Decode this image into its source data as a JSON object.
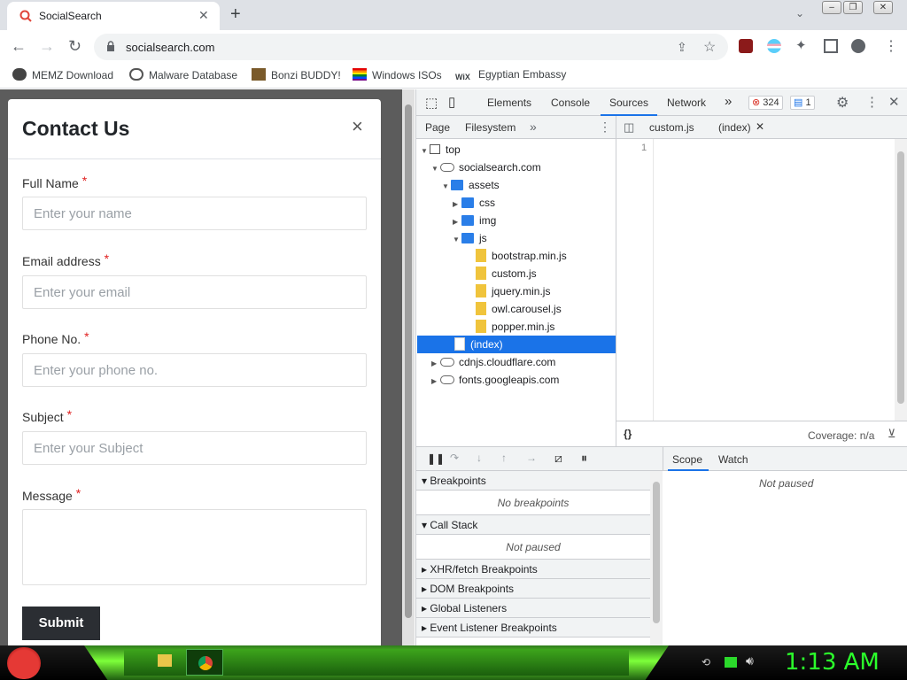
{
  "browser": {
    "tab_title": "SocialSearch",
    "url": "socialsearch.com",
    "bookmarks": [
      "MEMZ Download",
      "Malware Database",
      "Bonzi BUDDY!",
      "Windows ISOs",
      "Egyptian Embassy"
    ]
  },
  "modal": {
    "title": "Contact Us",
    "close_glyph": "×",
    "fields": [
      {
        "label": "Full Name",
        "placeholder": "Enter your name"
      },
      {
        "label": "Email address",
        "placeholder": "Enter your email"
      },
      {
        "label": "Phone No.",
        "placeholder": "Enter your phone no."
      },
      {
        "label": "Subject",
        "placeholder": "Enter your Subject"
      },
      {
        "label": "Message",
        "placeholder": ""
      }
    ],
    "required_mark": "*",
    "submit_label": "Submit"
  },
  "devtools": {
    "tabs": [
      "Elements",
      "Console",
      "Sources",
      "Network"
    ],
    "active_tab": "Sources",
    "more_glyph": "»",
    "error_count": "324",
    "message_count": "1",
    "navigator_tabs": [
      "Page",
      "Filesystem"
    ],
    "editor_tabs": [
      "custom.js",
      "(index)"
    ],
    "tree": {
      "top": "top",
      "domain": "socialsearch.com",
      "assets": "assets",
      "css": "css",
      "img": "img",
      "js": "js",
      "files": [
        "bootstrap.min.js",
        "custom.js",
        "jquery.min.js",
        "owl.carousel.js",
        "popper.min.js"
      ],
      "index": "(index)",
      "other_domains": [
        "cdnjs.cloudflare.com",
        "fonts.googleapis.com"
      ]
    },
    "line_number": "1",
    "format_glyph": "{}",
    "coverage": "Coverage: n/a",
    "scope_tabs": [
      "Scope",
      "Watch"
    ],
    "scope_body": "Not paused",
    "sections": {
      "breakpoints": "Breakpoints",
      "breakpoints_body": "No breakpoints",
      "call_stack": "Call Stack",
      "call_stack_body": "Not paused",
      "xhr": "XHR/fetch Breakpoints",
      "dom": "DOM Breakpoints",
      "global": "Global Listeners",
      "event": "Event Listener Breakpoints"
    }
  },
  "taskbar": {
    "clock": "1:13 AM"
  },
  "colors": {
    "accent": "#1a73e8",
    "required": "#e02020",
    "submit_bg": "#2b2e33",
    "clock": "#2bff2b"
  }
}
